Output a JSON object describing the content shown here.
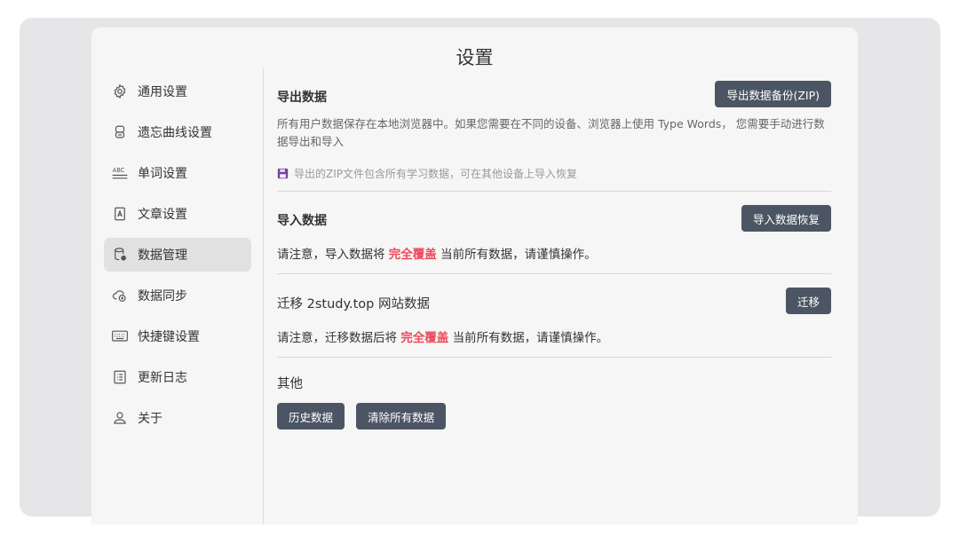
{
  "page": {
    "title": "设置"
  },
  "sidebar": {
    "items": [
      {
        "label": "通用设置",
        "icon": "gear-icon"
      },
      {
        "label": "遗忘曲线设置",
        "icon": "curve-icon"
      },
      {
        "label": "单词设置",
        "icon": "abc-icon"
      },
      {
        "label": "文章设置",
        "icon": "article-icon"
      },
      {
        "label": "数据管理",
        "icon": "database-icon"
      },
      {
        "label": "数据同步",
        "icon": "cloud-sync-icon"
      },
      {
        "label": "快捷键设置",
        "icon": "keyboard-icon"
      },
      {
        "label": "更新日志",
        "icon": "changelog-icon"
      },
      {
        "label": "关于",
        "icon": "user-icon"
      }
    ],
    "active_index": 4
  },
  "export": {
    "title": "导出数据",
    "button": "导出数据备份(ZIP)",
    "desc": "所有用户数据保存在本地浏览器中。如果您需要在不同的设备、浏览器上使用 Type Words， 您需要手动进行数据导出和导入",
    "hint": "导出的ZIP文件包含所有学习数据，可在其他设备上导入恢复"
  },
  "import": {
    "title": "导入数据",
    "button": "导入数据恢复",
    "note_before": "请注意，导入数据将",
    "note_highlight": "完全覆盖",
    "note_after": "当前所有数据，请谨慎操作。"
  },
  "migrate": {
    "title": "迁移 2study.top 网站数据",
    "button": "迁移",
    "note_before": "请注意，迁移数据后将",
    "note_highlight": "完全覆盖",
    "note_after": "当前所有数据，请谨慎操作。"
  },
  "other": {
    "title": "其他",
    "buttons": [
      "历史数据",
      "清除所有数据"
    ]
  },
  "colors": {
    "button_bg": "#4c5563",
    "highlight": "#f0485a",
    "save_icon": "#7b3fa0"
  }
}
